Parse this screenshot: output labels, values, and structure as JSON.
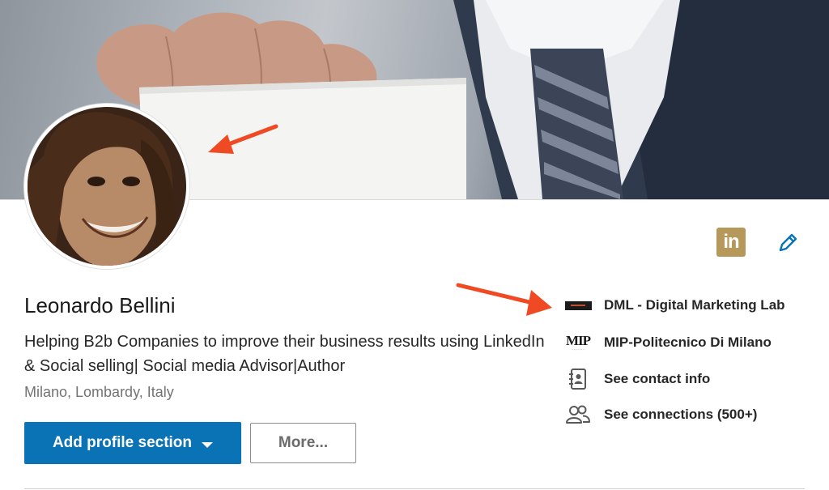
{
  "profile": {
    "name": "Leonardo Bellini",
    "headline": "Helping B2b Companies to improve their business results using LinkedIn & Social selling| Social media Advisor|Author",
    "location": "Milano, Lombardy, Italy"
  },
  "actions": {
    "linkedin_badge_label": "in",
    "add_profile_section_label": "Add profile section",
    "more_label": "More..."
  },
  "info_list": [
    {
      "icon": "dml-company-logo",
      "label": "DML - Digital Marketing Lab"
    },
    {
      "icon": "mip-school-logo",
      "label": "MIP-Politecnico Di Milano",
      "logo_text": "MIP"
    },
    {
      "icon": "contact-card-icon",
      "label": "See contact info"
    },
    {
      "icon": "connections-icon",
      "label": "See connections (500+)"
    }
  ],
  "colors": {
    "primary_button": "#0a73b6",
    "linkedin_badge": "#b5985a",
    "edit_icon": "#0a73b6",
    "annotation_arrow": "#f04a24"
  }
}
